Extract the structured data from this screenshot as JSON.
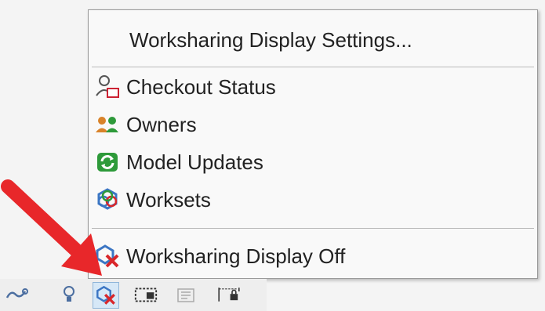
{
  "menu": {
    "settings_label": "Worksharing Display Settings...",
    "items": [
      {
        "label": "Checkout Status",
        "icon": "checkout-status-icon"
      },
      {
        "label": "Owners",
        "icon": "owners-icon"
      },
      {
        "label": "Model Updates",
        "icon": "model-updates-icon"
      },
      {
        "label": "Worksets",
        "icon": "worksets-icon"
      }
    ],
    "off_label": "Worksharing Display Off"
  },
  "statusbar": {
    "icons": [
      "link-icon",
      "lightbulb-icon",
      "worksharing-display-off-icon",
      "viewport-icon",
      "design-options-icon",
      "lock-icon"
    ]
  },
  "colors": {
    "arrow": "#e8272a",
    "green": "#2e9a3a",
    "orange": "#d9832a",
    "blue": "#3c76c4",
    "red": "#d9262a"
  }
}
